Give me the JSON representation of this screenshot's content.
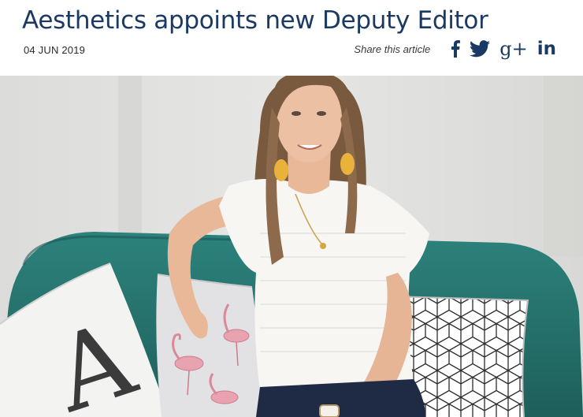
{
  "article": {
    "title": "Aesthetics appoints new Deputy Editor",
    "date": "04 JUN 2019"
  },
  "share": {
    "label": "Share this article",
    "icons": [
      "facebook-icon",
      "twitter-icon",
      "google-plus-icon",
      "linkedin-icon"
    ],
    "gplus_text": "g+",
    "linkedin_text": "in"
  },
  "photo": {
    "pillow_letter": "A"
  },
  "colors": {
    "brand": "#1b3a63",
    "text": "#2a2a2a",
    "sofa": "#2a7b75"
  }
}
